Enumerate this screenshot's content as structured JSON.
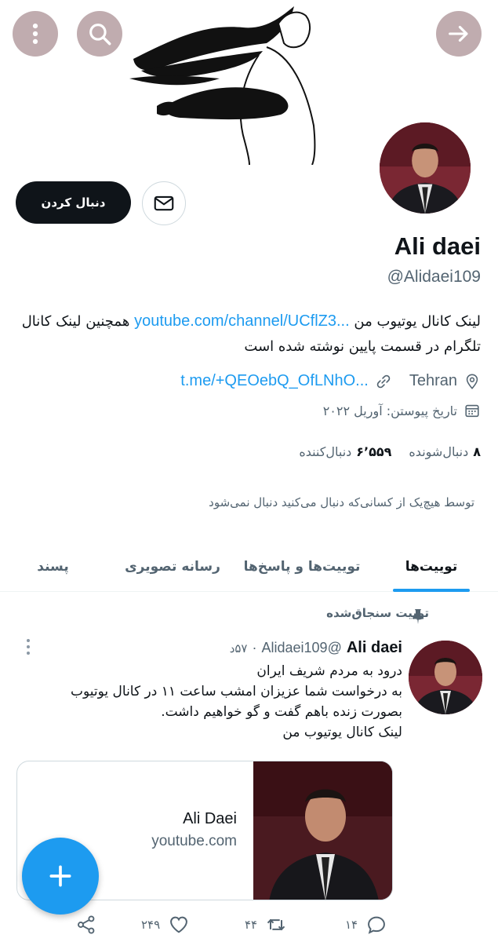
{
  "header": {
    "icons": {
      "menu": "more-vertical-icon",
      "search": "search-icon",
      "forward": "arrow-right-icon"
    }
  },
  "profile": {
    "name": "Ali daei",
    "handle": "@Alidaei109",
    "bio_prefix": "لینک کانال یوتیوب من",
    "bio_link": "youtube.com/channel/UCflZ3...",
    "bio_suffix": "همچنین لینک کانال تلگرام در قسمت پایین نوشته شده است",
    "location": "Tehran",
    "website": "t.me/+QEOebQ_OfLNhO...",
    "joined": "تاریخ پیوستن: آوریل ۲۰۲۲",
    "following_count": "۸",
    "following_label": "دنبال‌شونده",
    "followers_count": "۶٬۵۵۹",
    "followers_label": "دنبال‌کننده",
    "not_followed_notice": "توسط هیچ‌یک از کسانی‌که دنبال می‌کنید دنبال نمی‌شود"
  },
  "actions": {
    "follow_label": "دنبال کردن",
    "message_icon": "mail-icon"
  },
  "tabs": [
    {
      "label": "توییت‌ها",
      "active": true
    },
    {
      "label": "توییت‌ها و پاسخ‌ها",
      "active": false
    },
    {
      "label": "رسانه تصویری",
      "active": false
    },
    {
      "label": "پسند",
      "active": false
    }
  ],
  "pinned_tweet": {
    "pinned_label": "توییت سنجاق‌شده",
    "author_name": "Ali daei",
    "author_handle": "@Alidaei109",
    "separator": "·",
    "time": "۵۷د",
    "text_lines": [
      "درود به مردم شریف ایران",
      "به درخواست شما عزیزان امشب ساعت ۱۱ در کانال یوتیوب بصورت زنده باهم گفت و گو خواهیم داشت.",
      "لینک کانال یوتیوب من"
    ],
    "card": {
      "title": "Ali Daei",
      "domain": "youtube.com"
    },
    "stats": {
      "replies": "۱۴",
      "retweets": "۴۴",
      "likes": "۲۴۹"
    }
  },
  "fab": {
    "icon": "plus-icon"
  },
  "colors": {
    "accent": "#1d9bf0",
    "text": "#0f1419",
    "muted": "#536471",
    "header_buttons": "#8c686e"
  }
}
